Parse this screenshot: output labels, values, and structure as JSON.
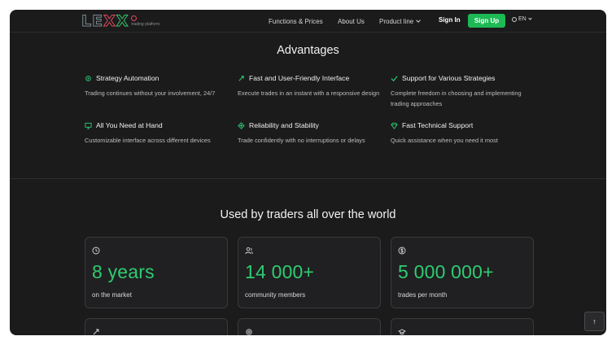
{
  "header": {
    "logo_text": "LEXX",
    "logo_sub": "trading platform",
    "nav": [
      {
        "label": "Functions & Prices"
      },
      {
        "label": "About Us"
      },
      {
        "label": "Product line"
      }
    ],
    "signin": "Sign In",
    "signup": "Sign Up",
    "lang": "EN",
    "accent": "#1db954"
  },
  "advantages": {
    "title": "Advantages",
    "items": [
      {
        "icon": "gear-icon",
        "title": "Strategy Automation",
        "desc": "Trading continues without your involvement, 24/7"
      },
      {
        "icon": "rocket-icon",
        "title": "Fast and User-Friendly Interface",
        "desc": "Execute trades in an instant with a responsive design"
      },
      {
        "icon": "check-icon",
        "title": "Support for Various Strategies",
        "desc": "Complete freedom in choosing and implementing trading approaches"
      },
      {
        "icon": "monitor-icon",
        "title": "All You Need at Hand",
        "desc": "Customizable interface across different devices"
      },
      {
        "icon": "shield-icon",
        "title": "Reliability and Stability",
        "desc": "Trade confidently with no interruptions or delays"
      },
      {
        "icon": "diamond-icon",
        "title": "Fast Technical Support",
        "desc": "Quick assistance when you need it most"
      }
    ]
  },
  "stats": {
    "title": "Used by traders all over the world",
    "cards": [
      {
        "icon": "clock-icon",
        "value": "8 years",
        "label": "on the market"
      },
      {
        "icon": "users-icon",
        "value": "14 000+",
        "label": "community members"
      },
      {
        "icon": "dollar-icon",
        "value": "5 000 000+",
        "label": "trades per month"
      }
    ],
    "more_cards": [
      {
        "icon": "rocket-icon"
      },
      {
        "icon": "gear-icon"
      },
      {
        "icon": "graduation-cap-icon"
      }
    ],
    "value_color": "#2ecc71"
  },
  "scroll_top_icon": "↑"
}
